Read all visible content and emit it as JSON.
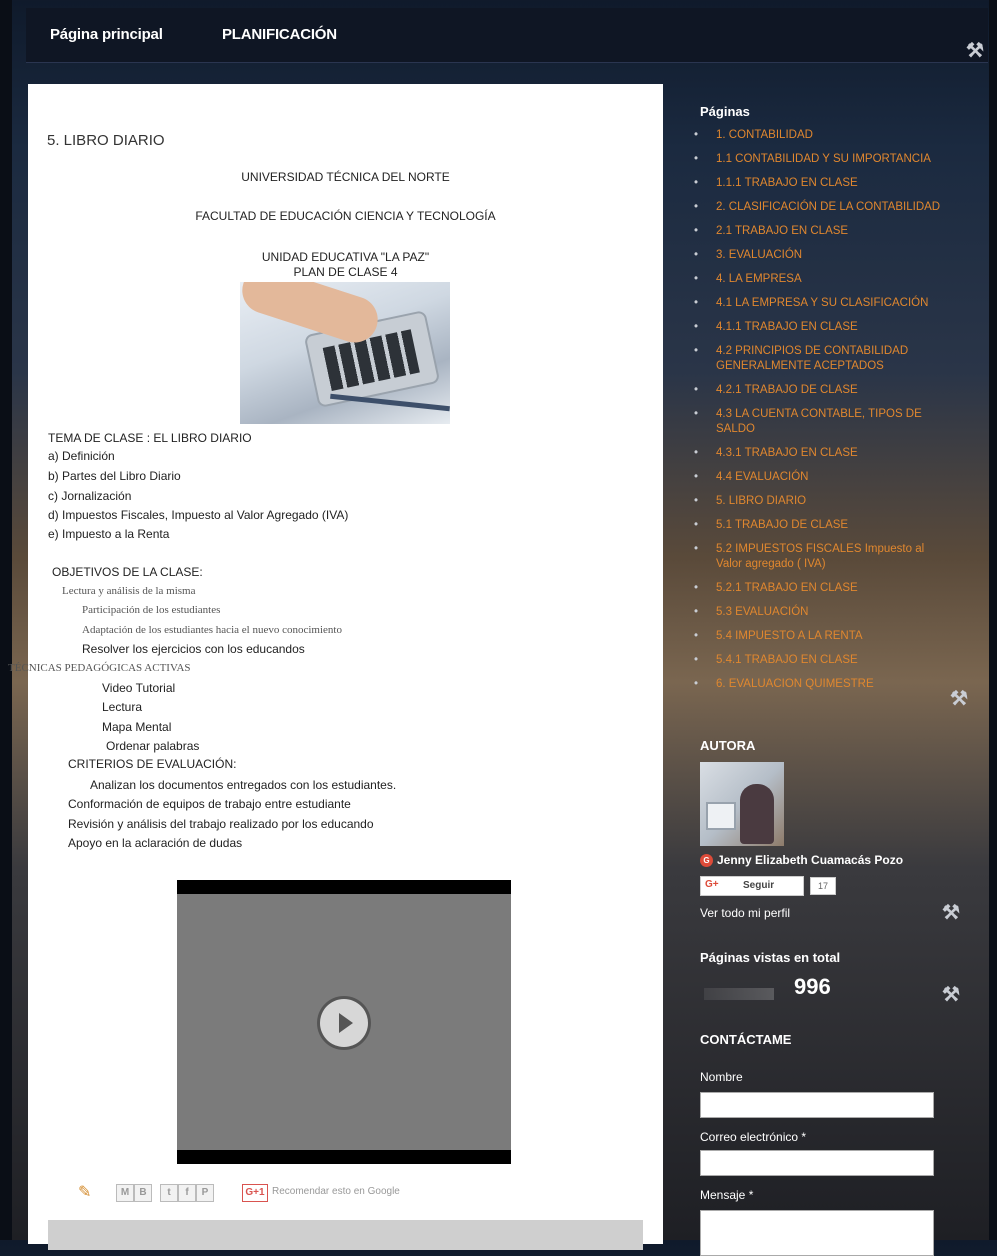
{
  "nav": {
    "home": "Página principal",
    "planning": "PLANIFICACIÓN"
  },
  "post": {
    "title": "5. LIBRO DIARIO",
    "university": "UNIVERSIDAD TÉCNICA DEL NORTE",
    "faculty": "FACULTAD DE EDUCACIÓN CIENCIA Y TECNOLOGÍA",
    "unit": "UNIDAD EDUCATIVA \"LA PAZ\"",
    "plan": "PLAN DE CLASE 4",
    "topic": "TEMA DE CLASE : EL LIBRO DIARIO",
    "topic_items": [
      "a) Definición",
      "b) Partes del Libro Diario",
      "c)  Jornalización",
      "d) Impuestos Fiscales, Impuesto al Valor Agregado (IVA)",
      "e) Impuesto a la Renta"
    ],
    "objectives_heading": "OBJETIVOS DE LA CLASE:",
    "objectives": [
      "Lectura y análisis de la misma",
      "Participación de los estudiantes",
      "Adaptación de los estudiantes hacia el nuevo conocimiento",
      "Resolver los ejercicios con los educandos"
    ],
    "techniques_heading": "TÉCNICAS PEDAGÓGICAS ACTIVAS",
    "techniques": [
      "Video Tutorial",
      "Lectura",
      "Mapa Mental",
      "Ordenar palabras"
    ],
    "criteria_heading": "CRITERIOS DE EVALUACIÓN:",
    "criteria": [
      "Analizan los documentos entregados con los estudiantes.",
      "Conformación de equipos de trabajo entre estudiante",
      "Revisión y análisis  del trabajo realizado por los educando",
      "Apoyo en la aclaración de dudas"
    ],
    "share": {
      "email": "M",
      "blog": "B",
      "twitter": "t",
      "facebook": "f",
      "pinterest": "P",
      "gplus": "G+1",
      "recommend": "Recomendar esto en Google"
    }
  },
  "sidebar": {
    "pages_heading": "Páginas",
    "pages": [
      "1. CONTABILIDAD",
      "1.1 CONTABILIDAD Y SU IMPORTANCIA",
      "1.1.1 TRABAJO EN CLASE",
      "2. CLASIFICACIÓN DE LA CONTABILIDAD",
      "2.1 TRABAJO EN CLASE",
      "3. EVALUACIÓN",
      "4. LA EMPRESA",
      "4.1 LA EMPRESA Y SU CLASIFICACIÓN",
      "4.1.1 TRABAJO EN CLASE",
      "4.2 PRINCIPIOS DE CONTABILIDAD GENERALMENTE ACEPTADOS",
      "4.2.1 TRABAJO DE CLASE",
      "4.3 LA CUENTA CONTABLE, TIPOS DE SALDO",
      "4.3.1 TRABAJO EN CLASE",
      "4.4 EVALUACIÓN",
      "5. LIBRO DIARIO",
      "5.1 TRABAJO DE CLASE",
      "5.2 IMPUESTOS FISCALES Impuesto al Valor agregado ( IVA)",
      "5.2.1 TRABAJO EN CLASE",
      "5.3 EVALUACIÓN",
      "5.4 IMPUESTO A LA RENTA",
      "5.4.1 TRABAJO EN CLASE",
      "6. EVALUACION QUIMESTRE"
    ],
    "author_heading": "AUTORA",
    "author_name": "Jenny Elizabeth Cuamacás Pozo",
    "follow_label": "Seguir",
    "follow_g": "G+",
    "follow_count": "17",
    "profile_link": "Ver todo mi perfil",
    "views_heading": "Páginas vistas en total",
    "views_count": "996",
    "contact_heading": "CONTÁCTAME",
    "name_label": "Nombre",
    "email_label": "Correo electrónico *",
    "message_label": "Mensaje *"
  }
}
